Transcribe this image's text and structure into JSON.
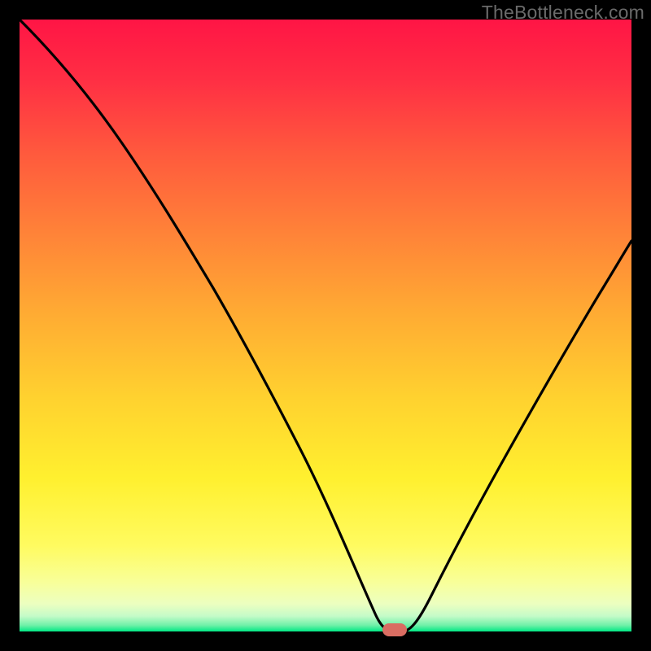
{
  "watermark": "TheBottleneck.com",
  "chart_data": {
    "type": "line",
    "title": "",
    "xlabel": "",
    "ylabel": "",
    "xlim": [
      0,
      100
    ],
    "ylim": [
      0,
      100
    ],
    "grid": false,
    "legend": false,
    "series": [
      {
        "name": "curve",
        "x": [
          0,
          5,
          10,
          15,
          20,
          25,
          30,
          35,
          40,
          45,
          50,
          55,
          58,
          60,
          62,
          65,
          70,
          75,
          80,
          85,
          90,
          95,
          100
        ],
        "y": [
          100,
          94,
          87,
          80,
          73,
          65,
          57,
          49,
          40,
          31,
          21,
          10,
          2,
          0,
          0,
          5,
          13,
          22,
          31,
          40,
          49,
          57,
          64
        ]
      }
    ],
    "marker": {
      "x": 60.5,
      "y": 0,
      "color": "#d96d62"
    },
    "background_gradient": {
      "top_color": "#ff1744",
      "mid_color": "#ffe030",
      "bottom_band_color": "#00e676"
    },
    "frame_color": "#000000"
  }
}
